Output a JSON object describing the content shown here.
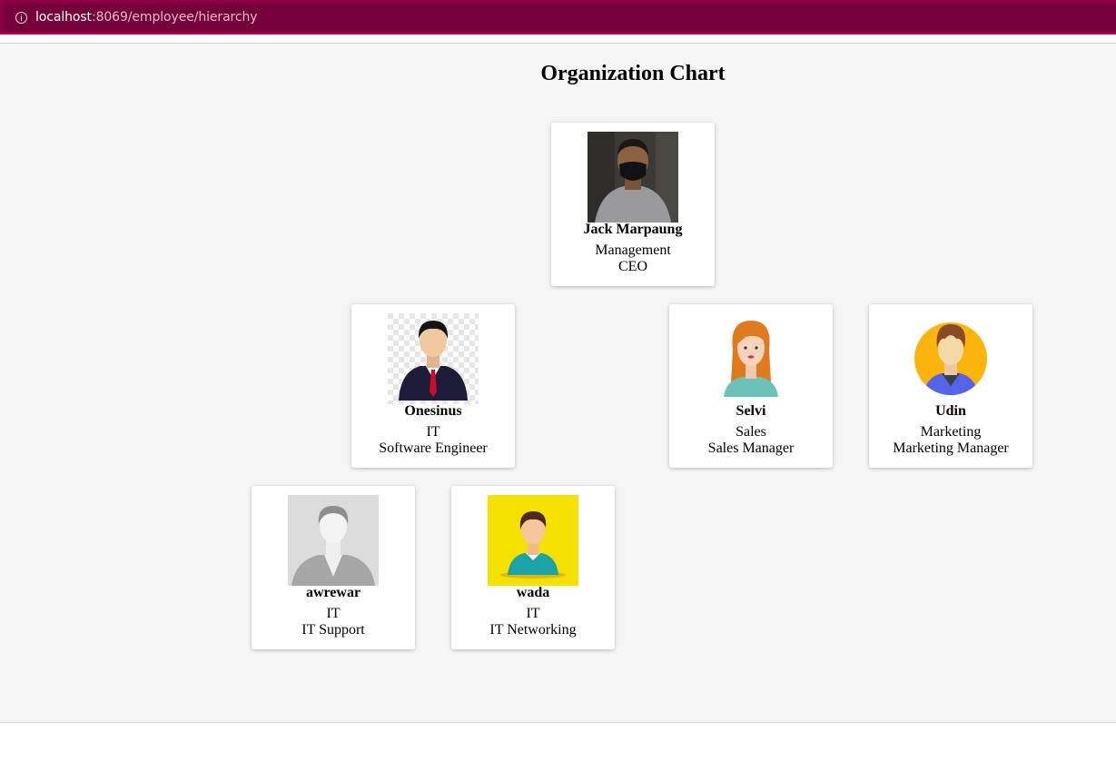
{
  "browser": {
    "url_host": "localhost",
    "url_path": ":8069/employee/hierarchy"
  },
  "page": {
    "title": "Organization Chart"
  },
  "employees": [
    {
      "name": "Jack Marpaung",
      "department": "Management",
      "job": "CEO",
      "avatar": "photo-man-mask"
    },
    {
      "name": "Onesinus",
      "department": "IT",
      "job": "Software Engineer",
      "avatar": "businessman-avatar"
    },
    {
      "name": "Selvi",
      "department": "Sales",
      "job": "Sales Manager",
      "avatar": "woman-avatar"
    },
    {
      "name": "Udin",
      "department": "Marketing",
      "job": "Marketing Manager",
      "avatar": "man-circle-avatar"
    },
    {
      "name": "awrewar",
      "department": "IT",
      "job": "IT Support",
      "avatar": "placeholder-avatar"
    },
    {
      "name": "wada",
      "department": "IT",
      "job": "IT Networking",
      "avatar": "boy-yellow-avatar"
    }
  ]
}
